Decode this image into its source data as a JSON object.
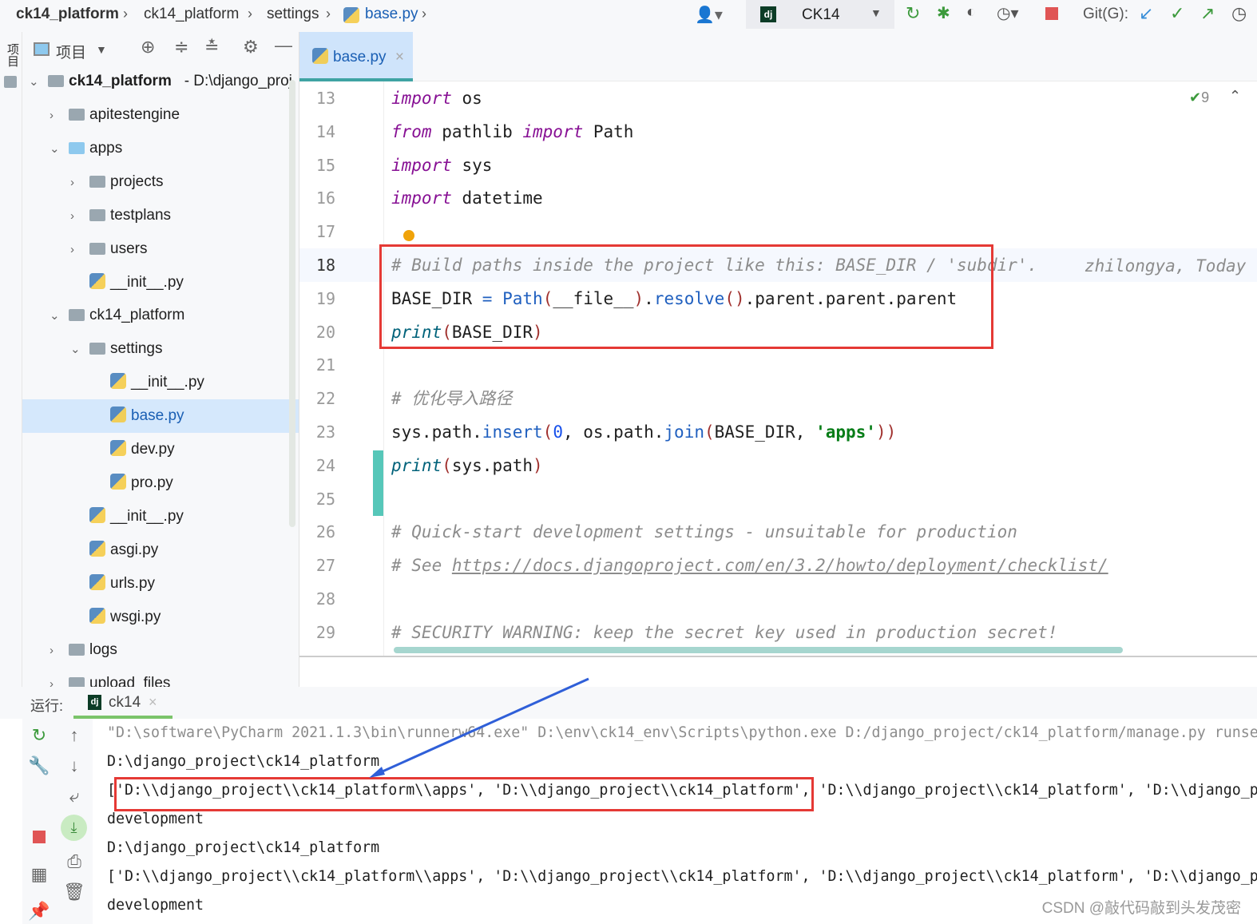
{
  "breadcrumb": [
    "ck14_platform",
    "ck14_platform",
    "settings",
    "base.py"
  ],
  "run_config": {
    "name": "CK14"
  },
  "git_label": "Git(G):",
  "project_panel": {
    "side_label": "项目",
    "header_label": "项目",
    "root": {
      "name": "ck14_platform",
      "path": "- D:\\django_proj"
    },
    "items": [
      {
        "label": "apitestengine",
        "depth": 1,
        "type": "folder",
        "chevron": "›"
      },
      {
        "label": "apps",
        "depth": 1,
        "type": "folder-blue",
        "chevron": "⌄"
      },
      {
        "label": "projects",
        "depth": 2,
        "type": "folder",
        "chevron": "›"
      },
      {
        "label": "testplans",
        "depth": 2,
        "type": "folder",
        "chevron": "›"
      },
      {
        "label": "users",
        "depth": 2,
        "type": "folder",
        "chevron": "›"
      },
      {
        "label": "__init__.py",
        "depth": 2,
        "type": "py",
        "chevron": ""
      },
      {
        "label": "ck14_platform",
        "depth": 1,
        "type": "folder",
        "chevron": "⌄"
      },
      {
        "label": "settings",
        "depth": 2,
        "type": "folder",
        "chevron": "⌄"
      },
      {
        "label": "__init__.py",
        "depth": 3,
        "type": "py",
        "chevron": ""
      },
      {
        "label": "base.py",
        "depth": 3,
        "type": "py",
        "chevron": "",
        "selected": true
      },
      {
        "label": "dev.py",
        "depth": 3,
        "type": "py",
        "chevron": ""
      },
      {
        "label": "pro.py",
        "depth": 3,
        "type": "py",
        "chevron": ""
      },
      {
        "label": "__init__.py",
        "depth": 2,
        "type": "py",
        "chevron": ""
      },
      {
        "label": "asgi.py",
        "depth": 2,
        "type": "py",
        "chevron": ""
      },
      {
        "label": "urls.py",
        "depth": 2,
        "type": "py",
        "chevron": ""
      },
      {
        "label": "wsgi.py",
        "depth": 2,
        "type": "py",
        "chevron": ""
      },
      {
        "label": "logs",
        "depth": 1,
        "type": "folder",
        "chevron": "›"
      },
      {
        "label": "upload_files",
        "depth": 1,
        "type": "folder",
        "chevron": "›"
      }
    ]
  },
  "editor": {
    "tab": "base.py",
    "inspection_count": "9",
    "blame": "zhilongya, Today",
    "lines": [
      {
        "n": "13",
        "t": [
          [
            "import",
            "kw"
          ],
          [
            " os",
            ""
          ]
        ]
      },
      {
        "n": "14",
        "t": [
          [
            "from",
            "kw"
          ],
          [
            " pathlib ",
            ""
          ],
          [
            "import",
            "kw"
          ],
          [
            " Path",
            ""
          ]
        ]
      },
      {
        "n": "15",
        "t": [
          [
            "import",
            "kw"
          ],
          [
            " sys",
            ""
          ]
        ]
      },
      {
        "n": "16",
        "t": [
          [
            "import",
            "kw"
          ],
          [
            " datetime",
            ""
          ]
        ]
      },
      {
        "n": "17",
        "t": []
      },
      {
        "n": "18",
        "t": [
          [
            "# Build paths inside the project like this: BASE_DIR / 'subdir'.",
            "cm"
          ]
        ],
        "current": true
      },
      {
        "n": "19",
        "t": [
          [
            "BASE_DIR ",
            ""
          ],
          [
            "=",
            "mt"
          ],
          [
            " ",
            ""
          ],
          [
            "Path",
            "mt"
          ],
          [
            "(",
            "pr"
          ],
          [
            "__file__",
            ""
          ],
          [
            ")",
            "pr"
          ],
          [
            ".",
            ""
          ],
          [
            "resolve",
            "mt"
          ],
          [
            "()",
            "pr"
          ],
          [
            ".parent.parent.parent",
            ""
          ]
        ]
      },
      {
        "n": "20",
        "t": [
          [
            "print",
            "fn"
          ],
          [
            "(",
            "pr"
          ],
          [
            "BASE_DIR",
            ""
          ],
          [
            ")",
            "pr"
          ]
        ]
      },
      {
        "n": "21",
        "t": []
      },
      {
        "n": "22",
        "t": [
          [
            "# 优化导入路径",
            "cm"
          ]
        ]
      },
      {
        "n": "23",
        "t": [
          [
            "sys.path.",
            ""
          ],
          [
            "insert",
            "mt"
          ],
          [
            "(",
            "pr"
          ],
          [
            "0",
            "nm"
          ],
          [
            ", os.path.",
            ""
          ],
          [
            "join",
            "mt"
          ],
          [
            "(",
            "pr"
          ],
          [
            "BASE_DIR, ",
            ""
          ],
          [
            "'apps'",
            "st"
          ],
          [
            "))",
            "pr"
          ]
        ]
      },
      {
        "n": "24",
        "t": [
          [
            "print",
            "fn"
          ],
          [
            "(",
            "pr"
          ],
          [
            "sys.path",
            ""
          ],
          [
            ")",
            "pr"
          ]
        ]
      },
      {
        "n": "25",
        "t": []
      },
      {
        "n": "26",
        "t": [
          [
            "# Quick-start development settings - unsuitable for production",
            "cm"
          ]
        ]
      },
      {
        "n": "27",
        "t": [
          [
            "# See ",
            "cm"
          ],
          [
            "https://docs.djangoproject.com/en/3.2/howto/deployment/checklist/",
            "cm ul"
          ]
        ]
      },
      {
        "n": "28",
        "t": []
      },
      {
        "n": "29",
        "t": [
          [
            "# SECURITY WARNING: keep the secret key used in production secret!",
            "cm"
          ]
        ]
      }
    ]
  },
  "run": {
    "label": "运行:",
    "tab": "ck14",
    "lines": [
      {
        "text": "\"D:\\software\\PyCharm 2021.1.3\\bin\\runnerw64.exe\" D:\\env\\ck14_env\\Scripts\\python.exe D:/django_project/ck14_platform/manage.py runse",
        "gray": true
      },
      {
        "text": "D:\\django_project\\ck14_platform"
      },
      {
        "text": "['D:\\\\django_project\\\\ck14_platform\\\\apps', 'D:\\\\django_project\\\\ck14_platform', 'D:\\\\django_project\\\\ck14_platform', 'D:\\\\django_p"
      },
      {
        "text": "development"
      },
      {
        "text": "D:\\django_project\\ck14_platform"
      },
      {
        "text": "['D:\\\\django_project\\\\ck14_platform\\\\apps', 'D:\\\\django_project\\\\ck14_platform', 'D:\\\\django_project\\\\ck14_platform', 'D:\\\\django_p"
      },
      {
        "text": "development"
      }
    ]
  },
  "watermark": "CSDN @敲代码敲到头发茂密",
  "colors": {
    "annotation_box": "#e53935",
    "arrow": "#2f5fd8",
    "selection": "#d5e8fc",
    "change_marker": "#56c7b9"
  }
}
